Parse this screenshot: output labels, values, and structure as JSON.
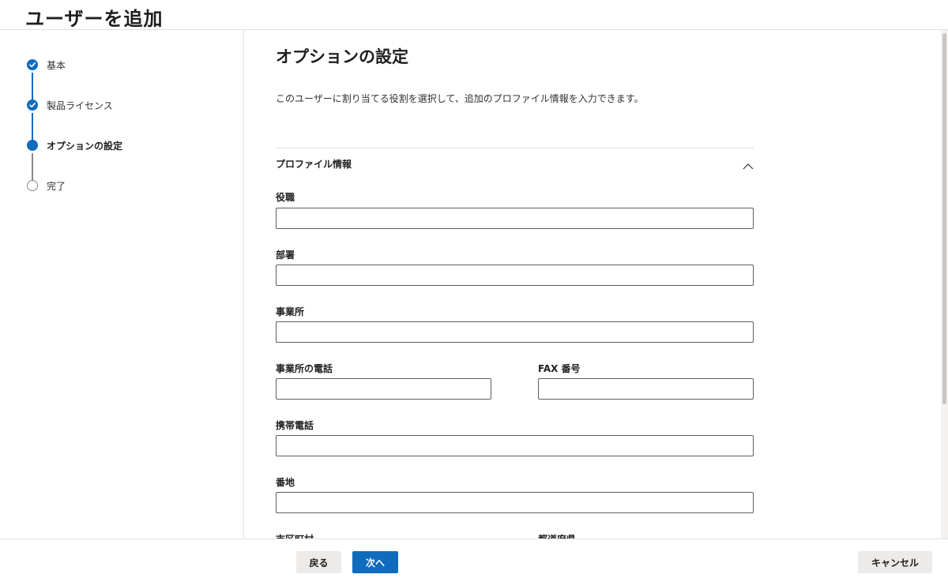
{
  "page_title": "ユーザーを追加",
  "steps": [
    {
      "label": "基本",
      "status": "done"
    },
    {
      "label": "製品ライセンス",
      "status": "done"
    },
    {
      "label": "オプションの設定",
      "status": "current"
    },
    {
      "label": "完了",
      "status": "todo"
    }
  ],
  "main": {
    "heading": "オプションの設定",
    "description": "このユーザーに割り当てる役割を選択して、追加のプロファイル情報を入力できます。",
    "section_title": "プロファイル情報",
    "fields": {
      "job_title": {
        "label": "役職",
        "value": ""
      },
      "department": {
        "label": "部署",
        "value": ""
      },
      "office": {
        "label": "事業所",
        "value": ""
      },
      "office_phone": {
        "label": "事業所の電話",
        "value": ""
      },
      "fax": {
        "label": "FAX 番号",
        "value": ""
      },
      "mobile_phone": {
        "label": "携帯電話",
        "value": ""
      },
      "street_address": {
        "label": "番地",
        "value": ""
      },
      "city": {
        "label": "市区町村"
      },
      "state": {
        "label": "都道府県"
      }
    }
  },
  "footer": {
    "back_label": "戻る",
    "next_label": "次へ",
    "cancel_label": "キャンセル"
  },
  "colors": {
    "accent": "#0f6cbd",
    "border": "#605e5c",
    "divider": "#e1dfdd"
  },
  "icons": {
    "step_done": "checkmark-circle-icon",
    "step_current": "filled-circle-icon",
    "step_todo": "empty-circle-icon",
    "section_toggle": "chevron-up-icon"
  }
}
